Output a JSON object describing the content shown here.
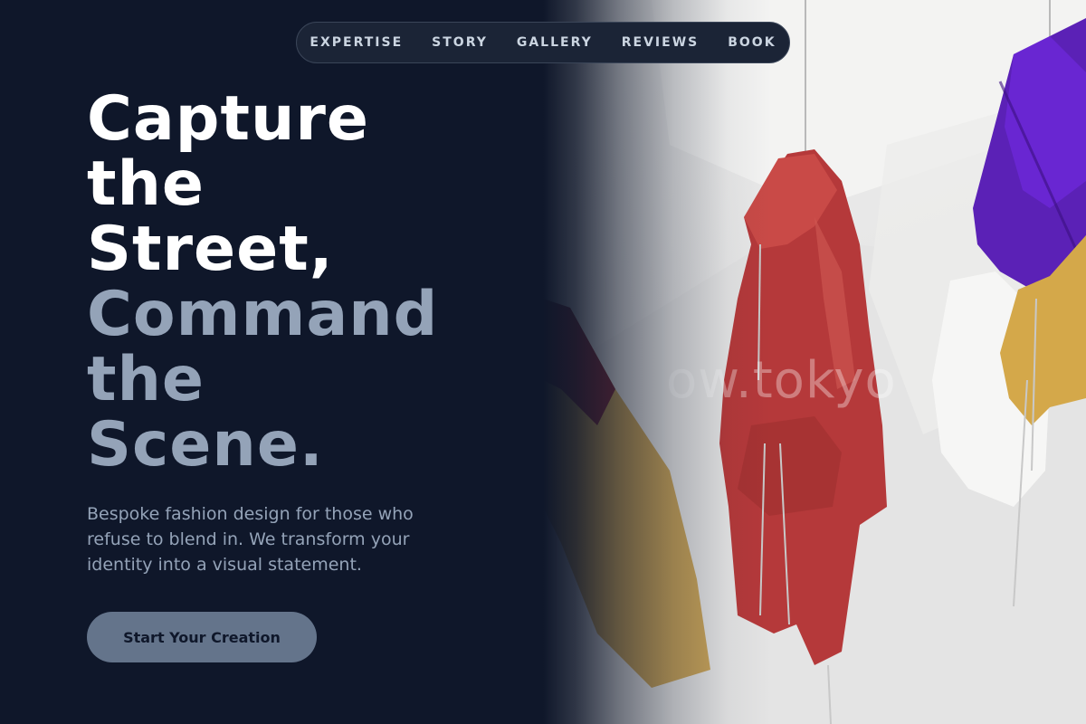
{
  "nav": {
    "items": [
      {
        "label": "EXPERTISE"
      },
      {
        "label": "STORY"
      },
      {
        "label": "GALLERY"
      },
      {
        "label": "REVIEWS"
      },
      {
        "label": "BOOK"
      }
    ]
  },
  "hero": {
    "headline_lines": [
      "Capture",
      "the",
      "Street,"
    ],
    "headline_accent_lines": [
      "Command",
      "the",
      "Scene."
    ],
    "subtitle": "Bespoke fashion design for those who refuse to blend in. We transform your identity into a visual statement.",
    "cta_label": "Start Your Creation"
  },
  "image": {
    "watermark": "ow.tokyo",
    "description_icon": "hanging-jackets-photo"
  },
  "colors": {
    "background": "#0f172a",
    "headline": "#ffffff",
    "accent": "#94a3b8",
    "cta": "#64748b"
  }
}
